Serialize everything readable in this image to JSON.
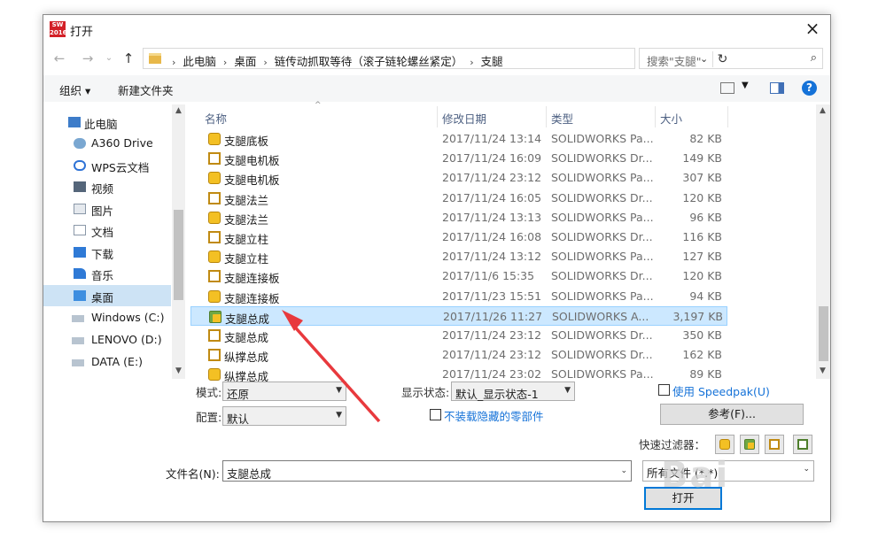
{
  "window": {
    "title": "打开",
    "app_icon_text": "SW 2016",
    "close_label": "×"
  },
  "nav": {
    "breadcrumbs": [
      "此电脑",
      "桌面",
      "链传动抓取等待（滚子链轮螺丝紧定）",
      "支腿"
    ],
    "search_placeholder": "搜索\"支腿\""
  },
  "toolbar": {
    "organize_label": "组织 ▾",
    "new_folder_label": "新建文件夹"
  },
  "sidebar": {
    "items": [
      {
        "label": "此电脑",
        "icon": "computer-icon",
        "selected": false
      },
      {
        "label": "A360 Drive",
        "icon": "cloud-drive-icon",
        "selected": false
      },
      {
        "label": "WPS云文档",
        "icon": "cloud-icon",
        "selected": false
      },
      {
        "label": "视频",
        "icon": "video-folder-icon",
        "selected": false
      },
      {
        "label": "图片",
        "icon": "pictures-folder-icon",
        "selected": false
      },
      {
        "label": "文档",
        "icon": "documents-folder-icon",
        "selected": false
      },
      {
        "label": "下载",
        "icon": "downloads-folder-icon",
        "selected": false
      },
      {
        "label": "音乐",
        "icon": "music-folder-icon",
        "selected": false
      },
      {
        "label": "桌面",
        "icon": "desktop-folder-icon",
        "selected": true
      },
      {
        "label": "Windows (C:)",
        "icon": "drive-icon",
        "selected": false
      },
      {
        "label": "LENOVO (D:)",
        "icon": "drive-icon",
        "selected": false
      },
      {
        "label": "DATA (E:)",
        "icon": "drive-icon",
        "selected": false
      }
    ]
  },
  "file_list": {
    "columns": [
      "名称",
      "修改日期",
      "类型",
      "大小"
    ],
    "rows": [
      {
        "name": "支腿底板",
        "date": "2017/11/24 13:14",
        "type": "SOLIDWORKS Pa...",
        "size": "82 KB",
        "icon": "sw-part-icon",
        "selected": false
      },
      {
        "name": "支腿电机板",
        "date": "2017/11/24 16:09",
        "type": "SOLIDWORKS Dr...",
        "size": "149 KB",
        "icon": "sw-drawing-icon",
        "selected": false
      },
      {
        "name": "支腿电机板",
        "date": "2017/11/24 23:12",
        "type": "SOLIDWORKS Pa...",
        "size": "307 KB",
        "icon": "sw-part-icon",
        "selected": false
      },
      {
        "name": "支腿法兰",
        "date": "2017/11/24 16:05",
        "type": "SOLIDWORKS Dr...",
        "size": "120 KB",
        "icon": "sw-drawing-icon",
        "selected": false
      },
      {
        "name": "支腿法兰",
        "date": "2017/11/24 13:13",
        "type": "SOLIDWORKS Pa...",
        "size": "96 KB",
        "icon": "sw-part-icon",
        "selected": false
      },
      {
        "name": "支腿立柱",
        "date": "2017/11/24 16:08",
        "type": "SOLIDWORKS Dr...",
        "size": "116 KB",
        "icon": "sw-drawing-icon",
        "selected": false
      },
      {
        "name": "支腿立柱",
        "date": "2017/11/24 13:12",
        "type": "SOLIDWORKS Pa...",
        "size": "127 KB",
        "icon": "sw-part-icon",
        "selected": false
      },
      {
        "name": "支腿连接板",
        "date": "2017/11/6 15:35",
        "type": "SOLIDWORKS Dr...",
        "size": "120 KB",
        "icon": "sw-drawing-icon",
        "selected": false
      },
      {
        "name": "支腿连接板",
        "date": "2017/11/23 15:51",
        "type": "SOLIDWORKS Pa...",
        "size": "94 KB",
        "icon": "sw-part-icon",
        "selected": false
      },
      {
        "name": "支腿总成",
        "date": "2017/11/26 11:27",
        "type": "SOLIDWORKS A...",
        "size": "3,197 KB",
        "icon": "sw-assembly-icon",
        "selected": true
      },
      {
        "name": "支腿总成",
        "date": "2017/11/24 23:12",
        "type": "SOLIDWORKS Dr...",
        "size": "350 KB",
        "icon": "sw-drawing-icon",
        "selected": false
      },
      {
        "name": "纵撑总成",
        "date": "2017/11/24 23:12",
        "type": "SOLIDWORKS Dr...",
        "size": "162 KB",
        "icon": "sw-drawing-icon",
        "selected": false
      },
      {
        "name": "纵撑总成",
        "date": "2017/11/24 23:02",
        "type": "SOLIDWORKS Pa...",
        "size": "89 KB",
        "icon": "sw-part-icon",
        "selected": false
      }
    ]
  },
  "options": {
    "mode_label": "模式:",
    "mode_value": "还原",
    "config_label": "配置:",
    "config_value": "默认",
    "display_state_label": "显示状态:",
    "display_state_value": "默认_显示状态-1",
    "hide_parts_label": "不装载隐藏的零部件",
    "speedpak_label": "使用 Speedpak(U)",
    "reference_label": "参考(F)...",
    "quick_filter_label": "快速过滤器："
  },
  "footer": {
    "filename_label": "文件名(N):",
    "filename_value": "支腿总成",
    "filetype_value": "所有文件 (*.*)",
    "open_label": "打开"
  },
  "overlay": {
    "watermark_text": "Bai",
    "arrow_color": "#e8393d"
  }
}
